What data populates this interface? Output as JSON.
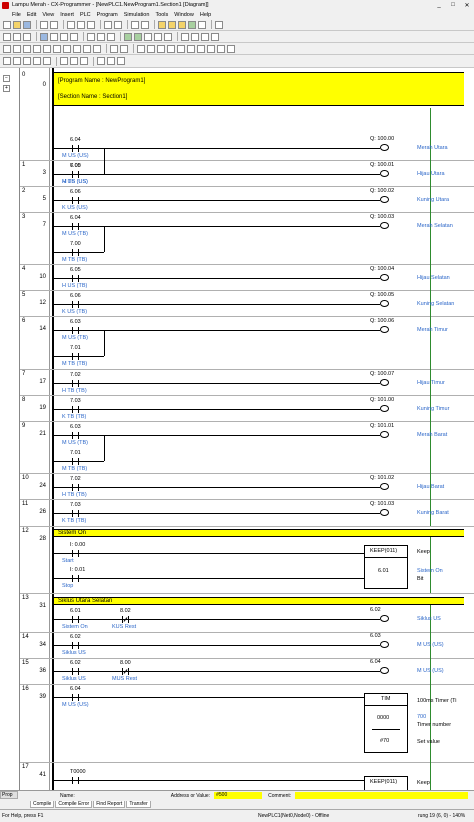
{
  "window": {
    "title": "Lampu Merah - CX-Programmer - [NewPLC1.NewProgram1.Section1 [Diagram]]",
    "controls": [
      "_",
      "□",
      "✕"
    ]
  },
  "menu": [
    "File",
    "Edit",
    "View",
    "Insert",
    "PLC",
    "Program",
    "Simulation",
    "Tools",
    "Window",
    "Help"
  ],
  "program_header": {
    "program_name": "[Program Name : NewProgram1]",
    "section_name": "[Section Name : Section1]"
  },
  "rung_numbers": [
    "0",
    "1",
    "2",
    "3",
    "4",
    "5",
    "6",
    "7",
    "8",
    "9",
    "10",
    "11",
    "12",
    "13",
    "14",
    "15",
    "16",
    "17"
  ],
  "step_numbers": [
    "0",
    "3",
    "5",
    "7",
    "10",
    "12",
    "14",
    "17",
    "19",
    "21",
    "24",
    "26",
    "28",
    "31",
    "34",
    "36",
    "39",
    "41"
  ],
  "contacts": [
    {
      "addr": "6.04",
      "name": "M US (US)"
    },
    {
      "addr": "7.00",
      "name": "M TB (US)"
    },
    {
      "addr": "6.05",
      "name": "H US (US)"
    },
    {
      "addr": "6.06",
      "name": "K US (US)"
    },
    {
      "addr": "6.04",
      "name": "M US (TB)"
    },
    {
      "addr": "7.00",
      "name": "M TB (TB)"
    },
    {
      "addr": "6.05",
      "name": "H US (TB)"
    },
    {
      "addr": "6.06",
      "name": "K US (TB)"
    },
    {
      "addr": "6.03",
      "name": "M US (TB)"
    },
    {
      "addr": "7.01",
      "name": "M TB (TB)"
    },
    {
      "addr": "7.02",
      "name": "H TB (TB)"
    },
    {
      "addr": "7.03",
      "name": "K TB (TB)"
    },
    {
      "addr": "6.03",
      "name": "M US (TB)"
    },
    {
      "addr": "7.01",
      "name": "M TB (TB)"
    },
    {
      "addr": "7.02",
      "name": "H TB (TB)"
    },
    {
      "addr": "7.03",
      "name": "K TB (TB)"
    },
    {
      "addr": "I: 0.00",
      "name": "Start"
    },
    {
      "addr": "I: 0.01",
      "name": "Stop"
    },
    {
      "addr": "6.01",
      "name": "Sistem On"
    },
    {
      "addr": "8.02",
      "name": "KUS Rest"
    },
    {
      "addr": "6.02",
      "name": "Siklus US"
    },
    {
      "addr": "6.02",
      "name": "Siklus US"
    },
    {
      "addr": "8.00",
      "name": "MUS Rest"
    },
    {
      "addr": "6.04",
      "name": "M US (US)"
    },
    {
      "addr": "T0000",
      "name": ""
    }
  ],
  "coils": [
    {
      "addr": "Q: 100.00",
      "name": "Merah Utara"
    },
    {
      "addr": "Q: 100.01",
      "name": "Hijau Utara"
    },
    {
      "addr": "Q: 100.02",
      "name": "Kuning Utara"
    },
    {
      "addr": "Q: 100.03",
      "name": "Merah Selatan"
    },
    {
      "addr": "Q: 100.04",
      "name": "Hijau Selatan"
    },
    {
      "addr": "Q: 100.05",
      "name": "Kuning Selatan"
    },
    {
      "addr": "Q: 100.06",
      "name": "Merah Timur"
    },
    {
      "addr": "Q: 100.07",
      "name": "Hijau Timur"
    },
    {
      "addr": "Q: 101.00",
      "name": "Kuning Timur"
    },
    {
      "addr": "Q: 101.01",
      "name": "Merah Barat"
    },
    {
      "addr": "Q: 101.02",
      "name": "Hijau Barat"
    },
    {
      "addr": "Q: 101.03",
      "name": "Kuning Barat"
    },
    {
      "addr": "6.02",
      "name": "Siklus US"
    },
    {
      "addr": "6.03",
      "name": "M US (US)"
    },
    {
      "addr": "6.04",
      "name": "M US (US)"
    }
  ],
  "comments": {
    "rung12": "Sistem On",
    "rung13": "Siklus Utara Selatan"
  },
  "keep_block": {
    "title": "KEEP(011)",
    "operand": "6.01",
    "side_title": "Keep",
    "side_name": "Sistem On",
    "side_type": "Bit"
  },
  "tim_block": {
    "title": "TIM",
    "timer_num": "0000",
    "set_value": "#70",
    "side_title": "100ms Timer (Ti",
    "side_timer_val": "700",
    "side_timer_label": "Timer number",
    "side_set_label": "Set value"
  },
  "keep_partial": "KEEP(011)",
  "keep_partial_side": "Keep",
  "bottom": {
    "name_label": "Name:",
    "address_label": "Address or Value:",
    "address_value": "#500",
    "comment_label": "Comment:"
  },
  "tabs": [
    "Compile",
    "Compile Error",
    "Find Report",
    "Transfer"
  ],
  "prop_label": "Prop",
  "status": {
    "help": "For Help, press F1",
    "plc": "NewPLC1(Net0,Node0) - Offline",
    "rung": "rung 19 (6, 0) - 140%"
  }
}
